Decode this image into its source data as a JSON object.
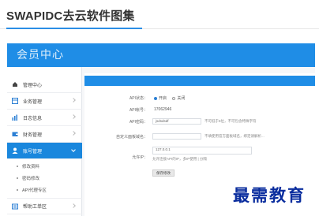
{
  "article": {
    "title": "SWAPIDC去云软件图集"
  },
  "app": {
    "brand": "会员中心",
    "colors": {
      "accent": "#1f8de6",
      "active": "#1a87dd"
    }
  },
  "sidebar": {
    "items": [
      {
        "label": "管理中心",
        "icon": "home-icon"
      },
      {
        "label": "业务管理",
        "icon": "grid-icon"
      },
      {
        "label": "日志信息",
        "icon": "bar-chart-icon"
      },
      {
        "label": "财务管理",
        "icon": "wallet-icon"
      },
      {
        "label": "账号管理",
        "icon": "user-icon"
      },
      {
        "label": "帮助工单区",
        "icon": "ticket-icon"
      }
    ],
    "subitems": [
      {
        "label": "修改资料"
      },
      {
        "label": "密码修改"
      },
      {
        "label": "API代理专区"
      }
    ]
  },
  "form": {
    "api_status": {
      "label": "API状态：",
      "on": "开启",
      "off": "关闭"
    },
    "api_account": {
      "label": "API帐号：",
      "value": "17062946"
    },
    "api_password": {
      "label": "API密码：",
      "value": "jsdsdsdf",
      "hint": "不可低于6位，不可包含特殊字符"
    },
    "custom_domain": {
      "label": "自定义面板域名：",
      "hint": "不填使用官方面板域名，绑定请解析..."
    },
    "allowed_ip": {
      "label": "允许IP：",
      "value": "127.0.0.1",
      "hint": "允许连接API的IP，多IP使用 | 分隔"
    },
    "save_button": "保存修改"
  },
  "watermark": "最需教育"
}
